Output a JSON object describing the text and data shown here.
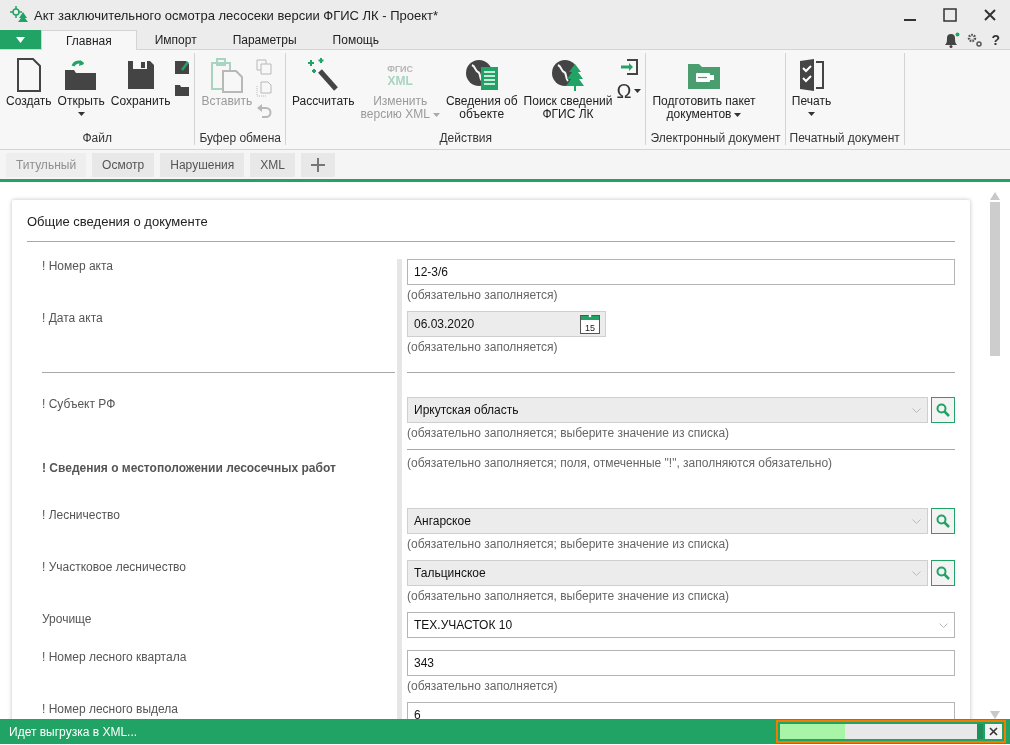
{
  "window": {
    "title": "Акт заключительного осмотра лесосеки версии ФГИС ЛК - Проект*"
  },
  "menu_tabs": [
    {
      "label": "Главная",
      "selected": true
    },
    {
      "label": "Импорт",
      "selected": false
    },
    {
      "label": "Параметры",
      "selected": false
    },
    {
      "label": "Помощь",
      "selected": false
    }
  ],
  "help": "?",
  "ribbon": {
    "groups": [
      {
        "label": "Файл",
        "buttons": [
          {
            "label": "Создать",
            "disabled": false
          },
          {
            "label": "Открыть",
            "disabled": false,
            "dropdown": true
          },
          {
            "label": "Сохранить",
            "disabled": false
          }
        ],
        "small": [
          {
            "disabled": false
          },
          {
            "disabled": false
          }
        ]
      },
      {
        "label": "Буфер обмена",
        "buttons": [
          {
            "label": "Вставить",
            "disabled": true
          }
        ],
        "small": [
          {
            "disabled": true
          },
          {
            "disabled": true
          },
          {
            "disabled": true
          }
        ]
      },
      {
        "label": "Действия",
        "buttons": [
          {
            "label": "Рассчитать",
            "disabled": false
          },
          {
            "label": "Изменить\nверсию XML",
            "disabled": true,
            "dropdown": true,
            "icon_text": [
              "ФГИС",
              "XML"
            ]
          },
          {
            "label": "Сведения об\nобъекте",
            "disabled": false
          },
          {
            "label": "Поиск сведений\nФГИС ЛК",
            "disabled": false
          }
        ],
        "small": [
          {
            "disabled": false
          },
          {
            "disabled": false,
            "symbol": "Ω",
            "dropdown": true
          }
        ]
      },
      {
        "label": "Электронный документ",
        "buttons": [
          {
            "label": "Подготовить пакет\nдокументов",
            "disabled": false,
            "dropdown": true
          }
        ]
      },
      {
        "label": "Печатный документ",
        "buttons": [
          {
            "label": "Печать",
            "disabled": false,
            "dropdown": true
          }
        ]
      }
    ]
  },
  "doc_tabs": [
    {
      "label": "Титульный",
      "selected": true
    },
    {
      "label": "Осмотр",
      "selected": false
    },
    {
      "label": "Нарушения",
      "selected": false
    },
    {
      "label": "XML",
      "selected": false
    }
  ],
  "form": {
    "title": "Общие сведения о документе",
    "rows": [
      {
        "kind": "text",
        "label": "! Номер акта",
        "value": "12-3/6",
        "hint": "(обязательно заполняется)"
      },
      {
        "kind": "date",
        "label": "! Дата акта",
        "value": "06.03.2020",
        "icon_text": "15",
        "hint": "(обязательно заполняется)"
      },
      {
        "kind": "divider"
      },
      {
        "kind": "lookup",
        "label": "! Субъект РФ",
        "value": "Иркутская область",
        "hint": "(обязательно заполняется; выберите значение из списка)"
      },
      {
        "kind": "section",
        "label": "! Сведения о местоположении лесосечных работ",
        "hint": "(обязательно заполняется; поля, отмеченные \"!\", заполняются обязательно)"
      },
      {
        "kind": "lookup",
        "label": "! Лесничество",
        "value": "Ангарское",
        "hint": "(обязательно заполняется; выберите значение из списка)"
      },
      {
        "kind": "lookup",
        "label": "! Участковое лесничество",
        "value": "Тальцинское",
        "hint": "(обязательно заполняется, выберите значение из списка)"
      },
      {
        "kind": "combo",
        "label": "Урочище",
        "value": "ТЕХ.УЧАСТОК 10"
      },
      {
        "kind": "text",
        "label": "! Номер лесного квартала",
        "value": "343",
        "hint": "(обязательно заполняется)"
      },
      {
        "kind": "text",
        "label": "! Номер лесного выдела",
        "value": "6"
      }
    ]
  },
  "status_bar": {
    "text": "Идет выгрузка в XML...",
    "progress": {
      "level": 0.33
    }
  }
}
